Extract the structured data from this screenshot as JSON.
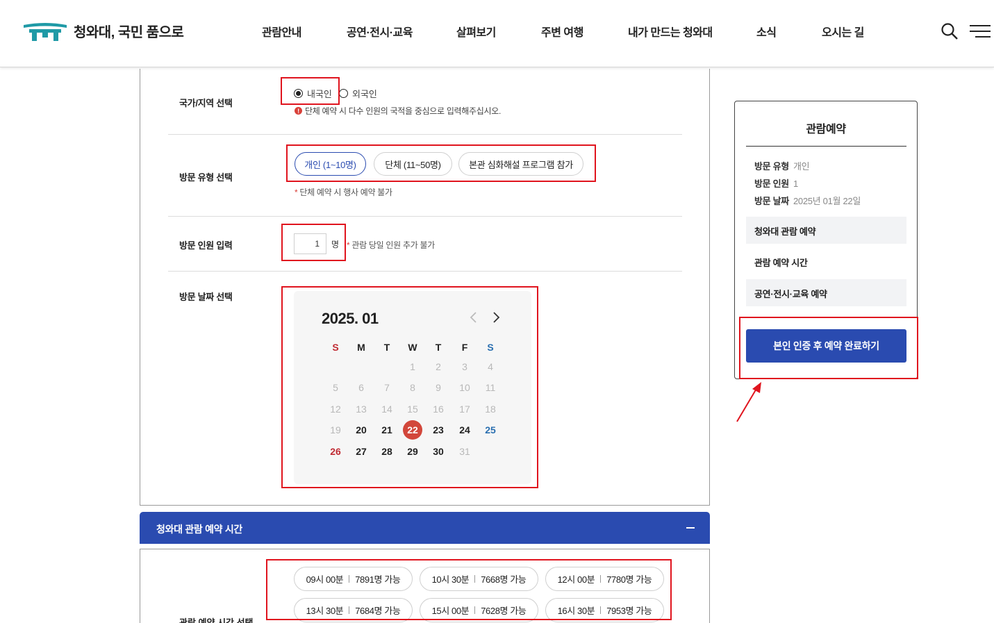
{
  "header": {
    "logo_text": "청와대, 국민 품으로",
    "nav": [
      "관람안내",
      "공연·전시·교육",
      "살펴보기",
      "주변 여행",
      "내가 만드는 청와대",
      "소식",
      "오시는 길"
    ]
  },
  "form": {
    "nationality": {
      "label": "국가/지역 선택",
      "options": [
        "내국인",
        "외국인"
      ],
      "selected": "내국인",
      "note": "단체 예약 시 다수 인원의 국적을 중심으로 입력해주십시오."
    },
    "visit_type": {
      "label": "방문 유형 선택",
      "options": [
        "개인 (1~10명)",
        "단체 (11~50명)",
        "본관 심화해설 프로그램 참가"
      ],
      "selected": "개인 (1~10명)",
      "note": "단체 예약 시 행사 예약 불가"
    },
    "visitor_count": {
      "label": "방문 인원 입력",
      "value": "1",
      "unit": "명",
      "note": "관람 당일 인원 추가 불가"
    },
    "visit_date": {
      "label": "방문 날짜 선택",
      "calendar": {
        "title": "2025. 01",
        "weekdays": [
          "S",
          "M",
          "T",
          "W",
          "T",
          "F",
          "S"
        ],
        "selected": 22
      }
    }
  },
  "time_section": {
    "title": "청와대 관람 예약 시간",
    "label": "관람 예약 시간 선택",
    "slots": [
      {
        "time": "09시 00분",
        "avail": "7891명 가능"
      },
      {
        "time": "10시 30분",
        "avail": "7668명 가능"
      },
      {
        "time": "12시 00분",
        "avail": "7780명 가능"
      },
      {
        "time": "13시 30분",
        "avail": "7684명 가능"
      },
      {
        "time": "15시 00분",
        "avail": "7628명 가능"
      },
      {
        "time": "16시 30분",
        "avail": "7953명 가능"
      }
    ]
  },
  "sidebar": {
    "title": "관람예약",
    "summary": [
      {
        "key": "방문 유형",
        "value": "개인"
      },
      {
        "key": "방문 인원",
        "value": "1"
      },
      {
        "key": "방문 날짜",
        "value": "2025년 01월 22일"
      }
    ],
    "blocks": [
      "청와대 관람 예약",
      "관람 예약 시간",
      "공연·전시·교육 예약"
    ],
    "cta": "본인 인증 후 예약 완료하기"
  },
  "colors": {
    "primary": "#2a4bb0",
    "highlight": "#e0141e",
    "selected_day": "#d2473b"
  }
}
